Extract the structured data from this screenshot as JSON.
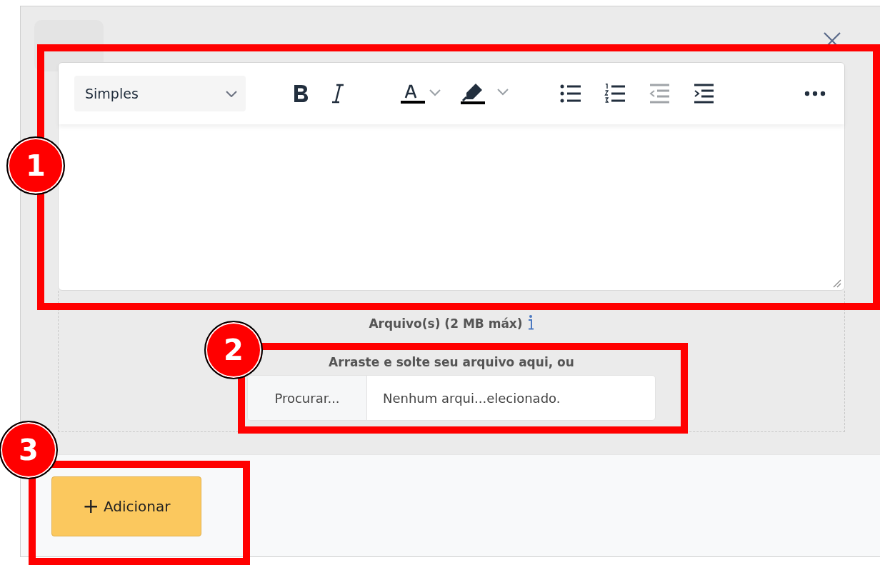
{
  "editor": {
    "block_format": "Simples",
    "toolbar": [
      {
        "kind": "bold",
        "disabled": false
      },
      {
        "kind": "italic",
        "disabled": false
      },
      {
        "kind": "font-color",
        "disabled": false
      },
      {
        "kind": "highlight",
        "disabled": false
      },
      {
        "kind": "bullet-list",
        "disabled": false
      },
      {
        "kind": "numbered-list",
        "disabled": false
      },
      {
        "kind": "outdent",
        "disabled": true
      },
      {
        "kind": "indent",
        "disabled": false
      },
      {
        "kind": "more",
        "disabled": false
      }
    ]
  },
  "attachments": {
    "label": "Arquivo(s) (2 MB máx)",
    "hint": "Arraste e solte seu arquivo aqui, ou",
    "browse_button": "Procurar...",
    "file_status": "Nenhum arqui...elecionado."
  },
  "footer": {
    "add_button": {
      "icon": "+",
      "label": "Adicionar"
    }
  },
  "annotations": [
    {
      "number": "1"
    },
    {
      "number": "2"
    },
    {
      "number": "3"
    }
  ]
}
